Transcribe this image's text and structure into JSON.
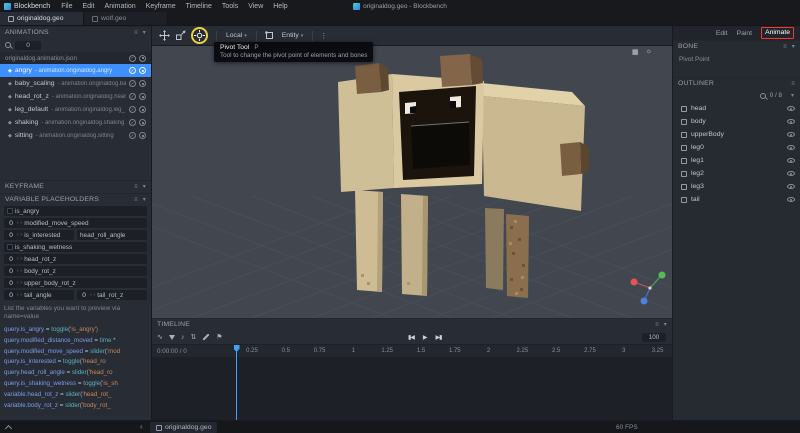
{
  "icons": {
    "menu": "≡",
    "collapse": "▾",
    "dots": "⋮",
    "check": "✓",
    "diamond": "◆",
    "wave": "∿",
    "note": "♪",
    "sort": "⇅",
    "flag": "⚑",
    "prev": "▮◀",
    "play": "▶",
    "next": "▶▮",
    "grid": "▦",
    "sun": "☼",
    "back": "‹",
    "dropdown": "▾",
    "stepper": "‹ ›"
  },
  "menubar": {
    "logo": "Blockbench",
    "items": [
      "File",
      "Edit",
      "Animation",
      "Keyframe",
      "Timeline",
      "Tools",
      "View",
      "Help"
    ],
    "window_title": "originaldog.geo - Blockbench"
  },
  "tabs": [
    {
      "label": "originaldog.geo",
      "active": true
    },
    {
      "label": "wolf.geo",
      "active": false
    }
  ],
  "toolbar": {
    "transform_space": "Local",
    "rotation_space": "Entity",
    "tooltip": {
      "title": "Pivot Tool",
      "shortcut": "P",
      "description": "Tool to change the pivot point of elements and bones"
    }
  },
  "modes": [
    {
      "label": "Edit",
      "active": false
    },
    {
      "label": "Paint",
      "active": false
    },
    {
      "label": "Animate",
      "active": true
    }
  ],
  "panels": {
    "animations": {
      "title": "ANIMATIONS",
      "counter": "0",
      "file": "originaldog.animation.json",
      "items": [
        {
          "name": "angry",
          "desc": "- animation.originaldog.angry",
          "selected": true
        },
        {
          "name": "baby_scaling",
          "desc": "- animation.originaldog.ba",
          "selected": false
        },
        {
          "name": "head_rot_z",
          "desc": "- animation.originaldog.hear",
          "selected": false
        },
        {
          "name": "leg_default",
          "desc": "- animation.originaldog.leg_",
          "selected": false
        },
        {
          "name": "shaking",
          "desc": "- animation.originaldog.shaking",
          "selected": false
        },
        {
          "name": "sitting",
          "desc": "- animation.originaldog.sitting",
          "selected": false
        }
      ]
    },
    "keyframe": {
      "title": "KEYFRAME"
    },
    "variables": {
      "title": "VARIABLE PLACEHOLDERS",
      "rows": [
        {
          "type": "checkbox",
          "label": "is_angry"
        },
        {
          "type": "slider",
          "value": "0",
          "label": "modified_move_speed"
        },
        {
          "type": "slider-pair",
          "value": "0",
          "label": "is_interested",
          "label2": "head_roll_angle"
        },
        {
          "type": "checkbox",
          "label": "is_shaking_wetness"
        },
        {
          "type": "slider",
          "value": "0",
          "label": "head_rot_z"
        },
        {
          "type": "slider",
          "value": "0",
          "label": "body_rot_z"
        },
        {
          "type": "slider",
          "value": "0",
          "label": "upper_body_rot_z"
        },
        {
          "type": "slider-two",
          "value": "0",
          "label": "tail_angle",
          "value2": "0",
          "label2": "tail_rot_z"
        }
      ],
      "hint": "List the variables you want to preview via name=value",
      "code": [
        "query.is_angry = toggle('is_angry')",
        "query.modified_distance_moved = time *",
        "query.modified_move_speed = slider('mod",
        "query.is_interested = toggle('head_ro",
        "query.head_roll_angle = slider('head_ro",
        "query.is_shaking_wetness = toggle('is_sh",
        "variable.head_rot_z = slider('head_rot_",
        "variable.body_rot_z = slider('body_rot_"
      ]
    },
    "bone": {
      "title": "BONE",
      "property": "Pivot Point"
    },
    "outliner": {
      "title": "OUTLINER",
      "count": "0 / 8",
      "items": [
        "head",
        "body",
        "upperBody",
        "leg0",
        "leg1",
        "leg2",
        "leg3",
        "tail"
      ]
    },
    "timeline": {
      "title": "TIMELINE",
      "time_display": "0:00:00 / 0",
      "zoom": "100",
      "ruler": [
        "0.25",
        "0.5",
        "0.75",
        "1",
        "1.25",
        "1.5",
        "1.75",
        "2",
        "2.25",
        "2.5",
        "2.75",
        "3",
        "3.25"
      ]
    }
  },
  "statusbar": {
    "file": "originaldog.geo",
    "fps": "60 FPS"
  }
}
